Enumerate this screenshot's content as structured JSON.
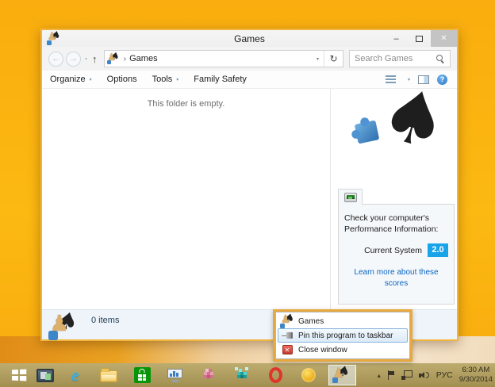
{
  "colors": {
    "desktop": "#fcb912",
    "window_border": "#f2b53c",
    "annotation_border": "#e7a83d",
    "score_badge": "#19a3e8",
    "link": "#0a64c0",
    "taskbar": "#b0a060"
  },
  "window": {
    "title": "Games",
    "address": {
      "location": "Games",
      "search_placeholder": "Search Games"
    },
    "toolbar": {
      "items": [
        {
          "label": "Organize",
          "dropdown": true
        },
        {
          "label": "Options",
          "dropdown": false
        },
        {
          "label": "Tools",
          "dropdown": true
        },
        {
          "label": "Family Safety",
          "dropdown": false
        }
      ]
    },
    "content": {
      "empty_message": "This folder is empty."
    },
    "details_pane": {
      "performance": {
        "heading": "Check your computer's Performance Information:",
        "row_label": "Current System",
        "score": "2.0",
        "link_text": "Learn more about these scores"
      }
    },
    "status_bar": {
      "items_count": "0 items"
    }
  },
  "context_menu": {
    "items": [
      {
        "label": "Games",
        "icon": "games-icon"
      },
      {
        "label": "Pin this program to taskbar",
        "icon": "pin-icon",
        "highlighted": true
      },
      {
        "label": "Close window",
        "icon": "close-red-icon"
      }
    ]
  },
  "taskbar": {
    "tray": {
      "language": "РУС",
      "time": "6:30 AM",
      "date": "9/30/2014"
    }
  },
  "icons": {
    "window_controls": {
      "minimize": "–",
      "close": "✕"
    },
    "nav": {
      "back": "←",
      "forward": "→",
      "up": "↑",
      "refresh": "↻",
      "dropdown": "▾",
      "breadcrumb_sep": "›"
    },
    "help": "?",
    "tray_hidden": "▴",
    "glyphs": {
      "spade": "♠",
      "pawn": "♟"
    }
  }
}
